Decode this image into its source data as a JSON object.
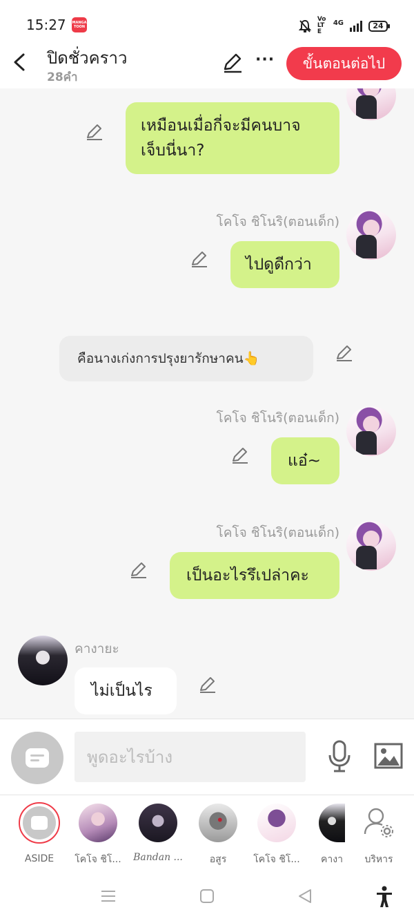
{
  "status_bar": {
    "time": "15:27",
    "app_badge": "MANGA TOON",
    "network": "4G",
    "volte": "Vo LTE",
    "battery": "24"
  },
  "header": {
    "title": "ปิดชั่วคราว",
    "subtitle": "28คำ",
    "next_button": "ขั้นตอนต่อไป",
    "more": "···"
  },
  "messages": [
    {
      "side": "right",
      "text_lines": [
        "เหมือนเมื่อกี่จะมีคนบาจ",
        "เจ็บนี่นา?"
      ]
    },
    {
      "side": "right",
      "name": "โคโจ ชิโนริ(ตอนเด็ก)",
      "text": "ไปดูดีกว่า"
    },
    {
      "side": "aside",
      "text": "คือนางเก่งการปรุงยารักษาคน👆"
    },
    {
      "side": "right",
      "name": "โคโจ ชิโนริ(ตอนเด็ก)",
      "text": "แอ๋~"
    },
    {
      "side": "right",
      "name": "โคโจ ชิโนริ(ตอนเด็ก)",
      "text": "เป็นอะไรรึเปล่าคะ"
    },
    {
      "side": "left",
      "name": "คางายะ",
      "text": "ไม่เป็นไร"
    }
  ],
  "input": {
    "placeholder": "พูดอะไรบ้าง"
  },
  "characters": [
    {
      "label": "ASIDE"
    },
    {
      "label": "โคโจ ชิโ..."
    },
    {
      "label": "Bandan ..."
    },
    {
      "label": "อสูร"
    },
    {
      "label": "โคโจ ชิโ..."
    },
    {
      "label": "คางา"
    },
    {
      "label": "บริหาร"
    }
  ],
  "colors": {
    "accent": "#f23b4c",
    "bubble_green": "#d4f28a",
    "aside_gray": "#ececec"
  }
}
